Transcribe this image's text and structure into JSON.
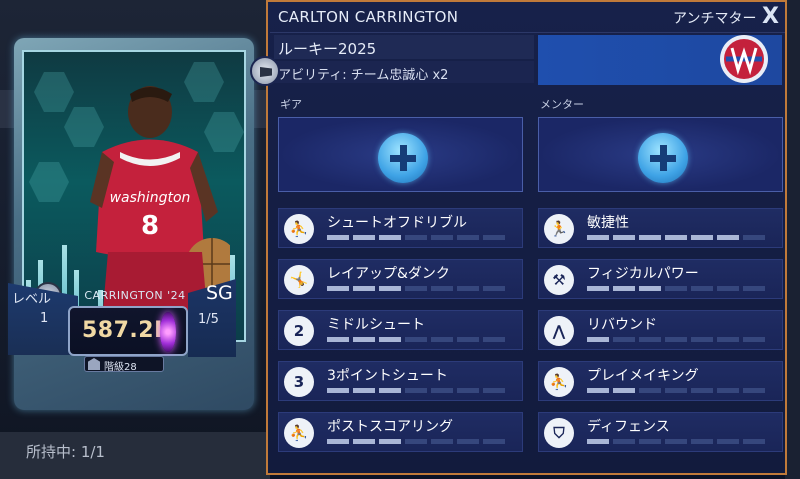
{
  "background": {
    "owned_label": "所持中: 1/1"
  },
  "card": {
    "name_band": "CARRINGTON '24",
    "level_label": "レベル",
    "level_value": "1",
    "position": "SG",
    "position_count": "1/5",
    "overall": "587.2K",
    "rank": "階級28",
    "team_jersey": "washington",
    "jersey_number": "8"
  },
  "panel": {
    "player_name": "CARLTON CARRINGTON",
    "tag": "アンチマター",
    "close_label": "X",
    "rookie": "ルーキー2025",
    "ability": "アビリティ: チーム忠誠心 x2",
    "gear_label": "ギア",
    "mentor_label": "メンター",
    "accent_color": "#c07a3a",
    "team_color": "#1f4fae"
  },
  "skills_left": [
    {
      "label": "シュートオフドリブル",
      "icon": "dribble-icon",
      "glyph": "⛹",
      "filled": 3
    },
    {
      "label": "レイアップ&ダンク",
      "icon": "dunk-icon",
      "glyph": "🤸",
      "filled": 3
    },
    {
      "label": "ミドルシュート",
      "icon": "two-point-icon",
      "glyph": "2",
      "filled": 3
    },
    {
      "label": "3ポイントシュート",
      "icon": "three-point-icon",
      "glyph": "3",
      "filled": 3
    },
    {
      "label": "ポストスコアリング",
      "icon": "post-icon",
      "glyph": "⛹",
      "filled": 3
    }
  ],
  "skills_right": [
    {
      "label": "敏捷性",
      "icon": "agility-icon",
      "glyph": "🏃",
      "filled": 6
    },
    {
      "label": "フィジカルパワー",
      "icon": "dumbbell-icon",
      "glyph": "⚒",
      "filled": 3
    },
    {
      "label": "リバウンド",
      "icon": "rebound-icon",
      "glyph": "⋀",
      "filled": 1
    },
    {
      "label": "プレイメイキング",
      "icon": "playmaking-icon",
      "glyph": "⛹",
      "filled": 2
    },
    {
      "label": "ディフェンス",
      "icon": "shield-icon",
      "glyph": "⛉",
      "filled": 1
    }
  ]
}
